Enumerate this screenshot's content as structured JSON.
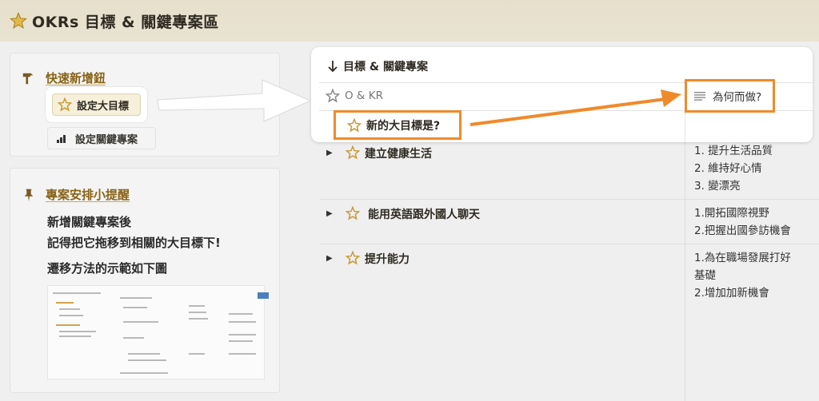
{
  "header": {
    "title": "OKRs 目標 & 關鍵專案區"
  },
  "quick_add": {
    "title": "快速新增鈕",
    "set_goal_button": "設定大目標",
    "set_project_button": "設定關鍵專案"
  },
  "tips": {
    "title": "專案安排小提醒",
    "line1": "新增關鍵專案後",
    "line2": "記得把它拖移到相關的大目標下!",
    "line3": "遷移方法的示範如下圖"
  },
  "popup": {
    "title": "目標 & 關鍵專案",
    "column_name": "O & KR",
    "column_reason": "為何而做?",
    "new_item": "新的大目標是?"
  },
  "goals": [
    {
      "name": "建立健康生活",
      "reasons": [
        "1. 提升生活品質",
        "2. 維持好心情",
        "3. 變漂亮"
      ]
    },
    {
      "name": "能用英語跟外國人聊天",
      "reasons": [
        "1.開拓國際視野",
        "2.把握出國參訪機會"
      ]
    },
    {
      "name": "提升能力",
      "reasons": [
        "1.為在職場發展打好",
        "基礎",
        "2.增加加新機會"
      ]
    }
  ],
  "colors": {
    "accent_orange": "#ef8a2a",
    "gold_star": "#c99a36",
    "header_bg": "#e7e0cc"
  }
}
